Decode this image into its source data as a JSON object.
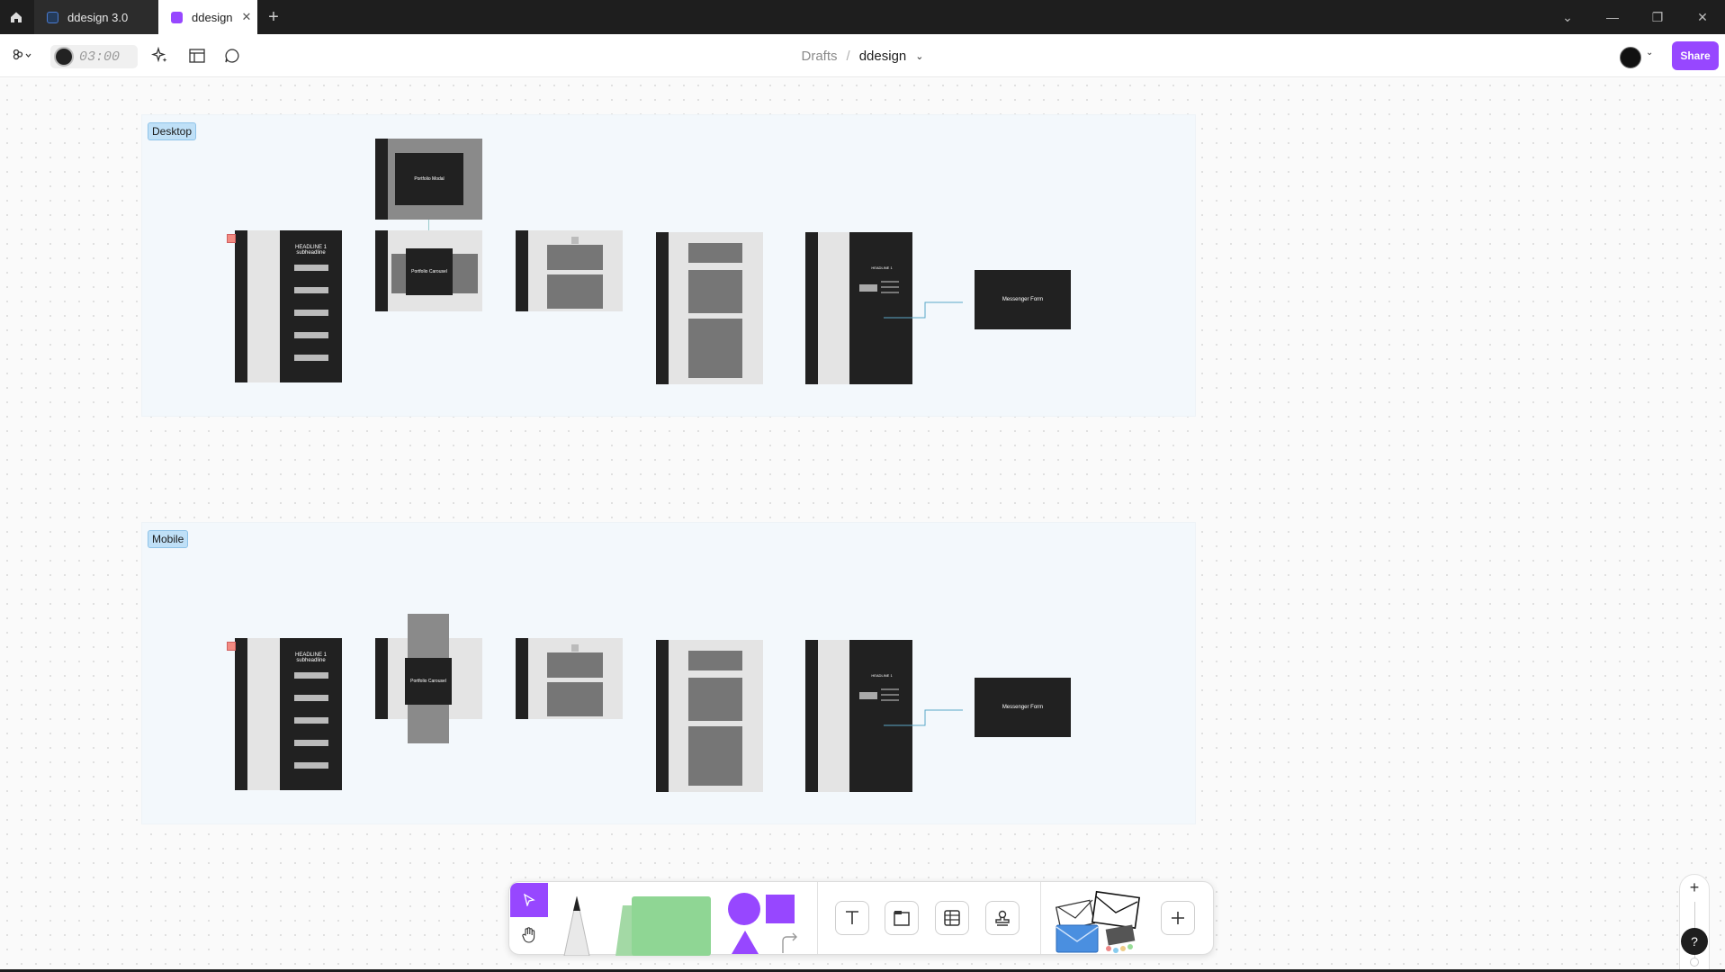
{
  "titlebar": {
    "tabs": [
      {
        "label": "ddesign 3.0",
        "color": "#1f6feb",
        "active": false
      },
      {
        "label": "ddesign",
        "color": "#9747ff",
        "active": true
      }
    ]
  },
  "toolbar": {
    "timer": "03:00"
  },
  "breadcrumb": {
    "drafts": "Drafts",
    "separator": "/",
    "file": "ddesign"
  },
  "share_label": "Share",
  "sections": {
    "desktop": {
      "label": "Desktop"
    },
    "mobile": {
      "label": "Mobile"
    }
  },
  "frames": {
    "headline": "HEADLINE 1",
    "subheadline": "subheadline",
    "portfolio_modal": "Portfolio Modal",
    "portfolio_carousel": "Portfolio Carousel",
    "messenger_form": "Messenger Form",
    "headline_small": "HEADLINE 1"
  },
  "accent_color": "#9747ff",
  "icons": [
    "home-icon",
    "figma-menu-icon",
    "timer-avatar",
    "sparkle-icon",
    "layout-icon",
    "comment-icon",
    "chevron-down-icon",
    "plus-icon",
    "minimize-icon",
    "restore-icon",
    "close-icon",
    "move-icon",
    "hand-icon",
    "pen-icon",
    "sticky-note-icon",
    "shapes-icon",
    "connector-icon",
    "text-icon",
    "section-icon",
    "table-icon",
    "stamp-icon",
    "envelopes-icon",
    "add-icon",
    "zoom-in-icon",
    "zoom-out-icon",
    "help-icon"
  ]
}
